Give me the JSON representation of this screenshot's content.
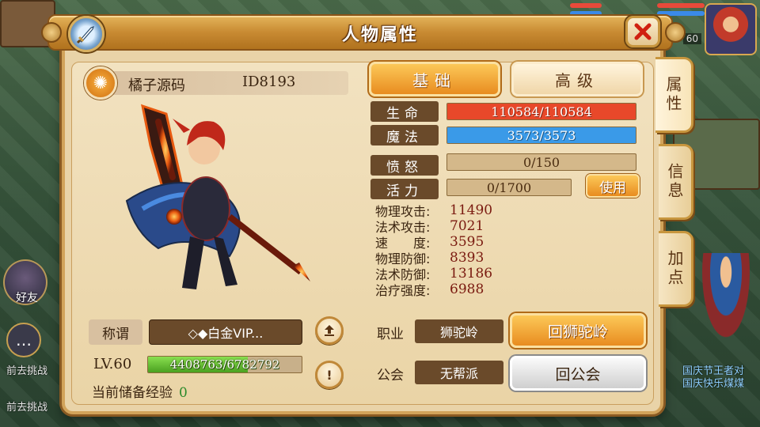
{
  "window": {
    "title": "人物属性"
  },
  "player": {
    "name": "橘子源码",
    "id": "ID8193"
  },
  "side_tabs": [
    {
      "label": "属性",
      "active": true
    },
    {
      "label": "信息",
      "active": false
    },
    {
      "label": "加点",
      "active": false
    }
  ],
  "tabs": {
    "basic": "基础",
    "advanced": "高级"
  },
  "bars": {
    "hp": {
      "label": "生命",
      "text": "110584/110584",
      "fraction": 1.0,
      "color": "#e8482a"
    },
    "mp": {
      "label": "魔法",
      "text": "3573/3573",
      "fraction": 1.0,
      "color": "#3a9ae8"
    },
    "rage": {
      "label": "愤怒",
      "text": "0/150",
      "fraction": 0.0,
      "color": "#d4b88a"
    },
    "vigor": {
      "label": "活力",
      "text": "0/1700",
      "fraction": 0.0,
      "color": "#d4b88a"
    }
  },
  "use_button": "使用",
  "attributes": [
    {
      "key": "物理攻击:",
      "value": "11490"
    },
    {
      "key": "法术攻击:",
      "value": "7021"
    },
    {
      "key": "速　　度:",
      "value": "3595"
    },
    {
      "key": "物理防御:",
      "value": "8393"
    },
    {
      "key": "法术防御:",
      "value": "13186"
    },
    {
      "key": "治疗强度:",
      "value": "6988"
    }
  ],
  "title_row": {
    "key": "称谓",
    "value": "◇◆白金VIP..."
  },
  "level": {
    "label": "LV.60",
    "exp_text": "4408763/6782792",
    "exp_fraction": 0.65
  },
  "stored_exp": {
    "label": "当前储备经验",
    "value": "0"
  },
  "school": {
    "key": "职业",
    "value": "狮驼岭",
    "button": "回狮驼岭"
  },
  "guild": {
    "key": "公会",
    "value": "无帮派",
    "button": "回公会"
  },
  "background": {
    "friend_label": "好友",
    "chat_lines": [
      "前去挑战",
      "前去挑战"
    ],
    "right_lines": [
      "国庆节王者对",
      "国庆快乐煤煤"
    ],
    "portrait_level": "60"
  },
  "colors": {
    "accent": "#e88c20",
    "panel": "#e9d3a8",
    "brown_label": "#6a4a2a"
  }
}
